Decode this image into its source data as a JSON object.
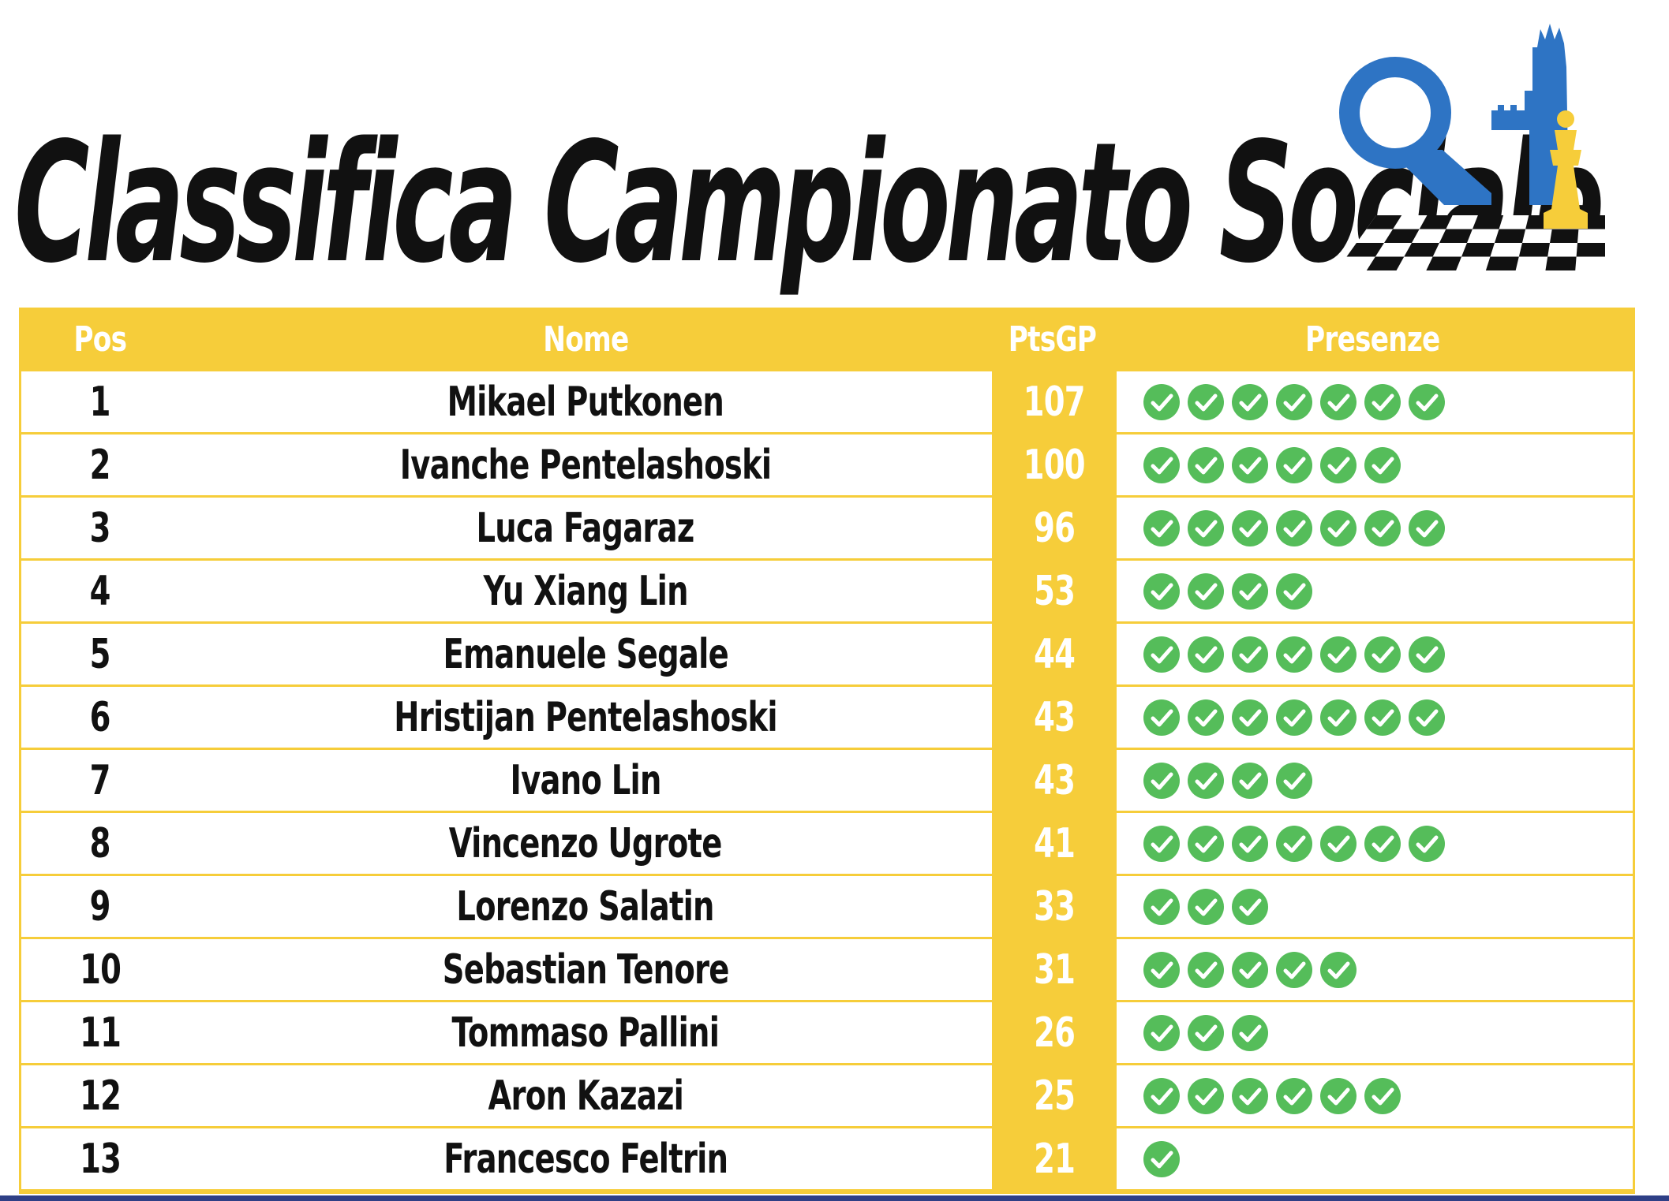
{
  "title": "Classifica Campionato Sociale",
  "logo": {
    "name": "chess-club-logo",
    "colors": {
      "blue": "#2e74c4",
      "gold": "#f6cd3a",
      "black": "#111111"
    }
  },
  "colors": {
    "accent": "#f6cd3a",
    "check": "#55bd5a",
    "text": "#111111",
    "footer": "#2e3f86"
  },
  "icons": {
    "presence": "check-circle-icon"
  },
  "table": {
    "headers": {
      "pos": "Pos",
      "name": "Nome",
      "points": "PtsGP",
      "presences": "Presenze"
    },
    "rows": [
      {
        "pos": "1",
        "name": "Mikael Putkonen",
        "points": "107",
        "presences": 7
      },
      {
        "pos": "2",
        "name": "Ivanche Pentelashoski",
        "points": "100",
        "presences": 6
      },
      {
        "pos": "3",
        "name": "Luca Fagaraz",
        "points": "96",
        "presences": 7
      },
      {
        "pos": "4",
        "name": "Yu Xiang Lin",
        "points": "53",
        "presences": 4
      },
      {
        "pos": "5",
        "name": "Emanuele Segale",
        "points": "44",
        "presences": 7
      },
      {
        "pos": "6",
        "name": "Hristijan Pentelashoski",
        "points": "43",
        "presences": 7
      },
      {
        "pos": "7",
        "name": "Ivano Lin",
        "points": "43",
        "presences": 4
      },
      {
        "pos": "8",
        "name": "Vincenzo Ugrote",
        "points": "41",
        "presences": 7
      },
      {
        "pos": "9",
        "name": "Lorenzo Salatin",
        "points": "33",
        "presences": 3
      },
      {
        "pos": "10",
        "name": "Sebastian Tenore",
        "points": "31",
        "presences": 5
      },
      {
        "pos": "11",
        "name": "Tommaso Pallini",
        "points": "26",
        "presences": 3
      },
      {
        "pos": "12",
        "name": "Aron Kazazi",
        "points": "25",
        "presences": 6
      },
      {
        "pos": "13",
        "name": "Francesco Feltrin",
        "points": "21",
        "presences": 1
      }
    ]
  }
}
